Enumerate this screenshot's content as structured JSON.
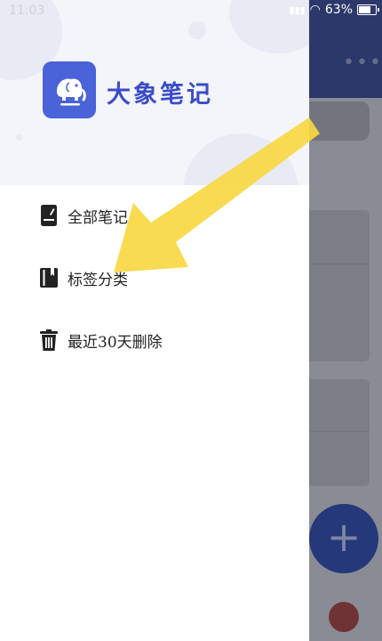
{
  "status_bar": {
    "time": "11:03",
    "battery": "63%"
  },
  "drawer": {
    "app_name": "大象笔记",
    "menu": [
      {
        "label": "全部笔记",
        "icon": "note-icon"
      },
      {
        "label": "标签分类",
        "icon": "notebook-icon"
      },
      {
        "label": "最近30天删除",
        "icon": "trash-icon"
      }
    ]
  },
  "background_app": {
    "fab_symbol": "+",
    "more_symbol": "•••"
  },
  "colors": {
    "brand": "#4a63d8",
    "brand_text": "#3a4cc8",
    "fab": "#2d4aa6",
    "arrow": "#f7d842"
  }
}
